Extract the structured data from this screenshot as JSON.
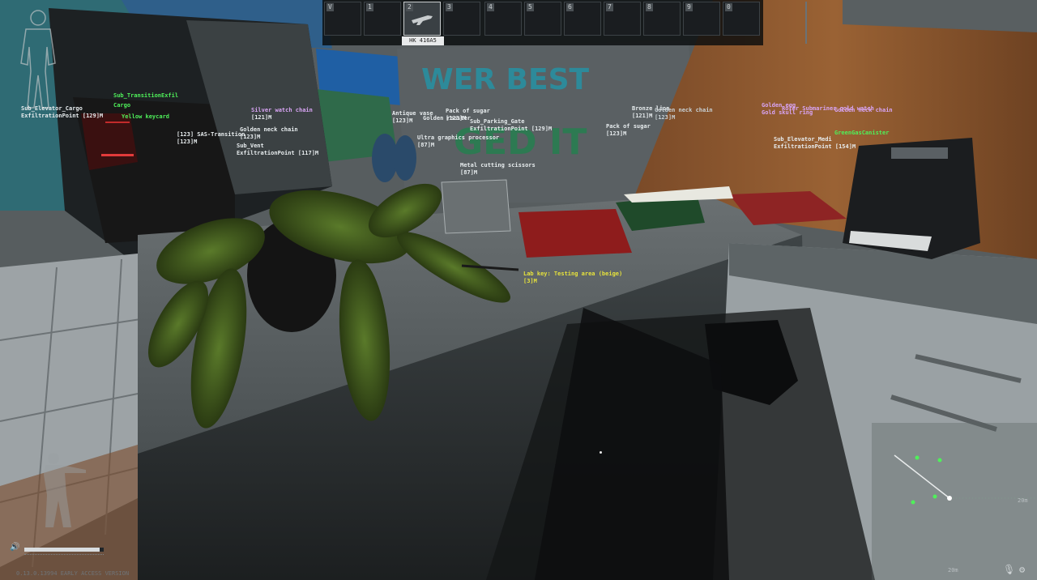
{
  "hotbar": {
    "slots": [
      {
        "num": "V"
      },
      {
        "num": "1"
      },
      {
        "num": "2",
        "active": true
      },
      {
        "num": "3"
      },
      {
        "num": "4"
      },
      {
        "num": "5"
      },
      {
        "num": "6"
      },
      {
        "num": "7"
      },
      {
        "num": "8"
      },
      {
        "num": "9"
      },
      {
        "num": "0"
      }
    ],
    "active_caption": "HK 416A5"
  },
  "poster_text": [
    "WER BEST",
    "GED IT"
  ],
  "debug_labels": [
    {
      "text": "Sub_Elevator_Cargo",
      "cls": "w"
    },
    {
      "text": "ExfiltrationPoint [129]M",
      "cls": "w"
    },
    {
      "text": "Sub_TransitionExfil",
      "cls": "g"
    },
    {
      "text": "Cargo",
      "cls": "g"
    },
    {
      "text": "Yellow keycard",
      "cls": "g"
    },
    {
      "text": "Silver watch chain",
      "cls": "p"
    },
    {
      "text": "[121]M",
      "cls": "w"
    },
    {
      "text": "Golden neck chain",
      "cls": "w"
    },
    {
      "text": "[123]M",
      "cls": "w"
    },
    {
      "text": "[123] SAS-Transition",
      "cls": "w"
    },
    {
      "text": "[123]M",
      "cls": "w"
    },
    {
      "text": "Sub_Vent",
      "cls": "w"
    },
    {
      "text": "ExfiltrationPoint [117]M",
      "cls": "w"
    },
    {
      "text": "Antique vase",
      "cls": "w"
    },
    {
      "text": "[123]M",
      "cls": "w"
    },
    {
      "text": "Pack of sugar",
      "cls": "w"
    },
    {
      "text": "Golden rooster",
      "cls": "w"
    },
    {
      "text": "[123]M",
      "cls": "w"
    },
    {
      "text": "Sub_Parking_Gate",
      "cls": "w"
    },
    {
      "text": "ExfiltrationPoint [129]M",
      "cls": "w"
    },
    {
      "text": "Ultra graphics processor",
      "cls": "w"
    },
    {
      "text": "[87]M",
      "cls": "w"
    },
    {
      "text": "Metal cutting scissors",
      "cls": "w"
    },
    {
      "text": "[87]M",
      "cls": "w"
    },
    {
      "text": "Pack of sugar",
      "cls": "w"
    },
    {
      "text": "[123]M",
      "cls": "w"
    },
    {
      "text": "Bronze lion",
      "cls": "w"
    },
    {
      "text": "[121]M",
      "cls": "w"
    },
    {
      "text": "Golden neck chain",
      "cls": "w"
    },
    {
      "text": "[123]M",
      "cls": "w"
    },
    {
      "text": "GreenGasCanister",
      "cls": "g"
    },
    {
      "text": "Golden egg",
      "cls": "p"
    },
    {
      "text": "Golden neck chain",
      "cls": "p"
    },
    {
      "text": "Gold skull ring",
      "cls": "p"
    },
    {
      "text": "Roler Submariner gold watch",
      "cls": "p"
    },
    {
      "text": "Sub_Elevator_Medi",
      "cls": "w"
    },
    {
      "text": "ExfiltrationPoint [154]M",
      "cls": "w"
    },
    {
      "text": "Lab key: Testing area (beige)",
      "cls": "y"
    },
    {
      "text": "[3]M",
      "cls": "y"
    }
  ],
  "volume": {
    "icon": "speaker-icon",
    "level_pct": 0.95
  },
  "status_line": "0.13.0.13994  EARLY ACCESS VERSION",
  "compass": {
    "zoom_label": "20m",
    "scale_label": "20m"
  },
  "colors": {
    "debug_green": "#4ff05a",
    "debug_yellow": "#e6e23c",
    "debug_purple": "#d8a4f4"
  }
}
